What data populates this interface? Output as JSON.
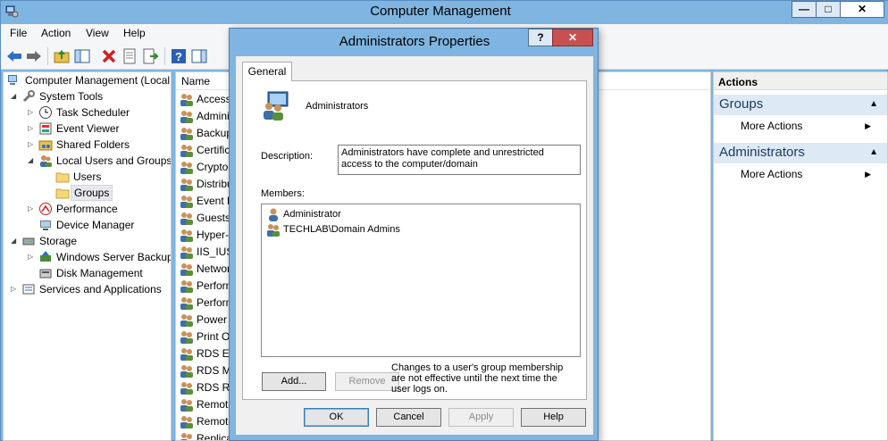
{
  "window": {
    "title": "Computer Management",
    "minimize": "—",
    "maximize": "□",
    "close": "✕"
  },
  "menu": [
    "File",
    "Action",
    "View",
    "Help"
  ],
  "tree": [
    {
      "label": "Computer Management (Local",
      "expander": "",
      "icon": "computer-icon"
    },
    {
      "label": "System Tools",
      "expander": "◢",
      "icon": "tools-icon"
    },
    {
      "label": "Task Scheduler",
      "expander": "▷",
      "icon": "clock-icon"
    },
    {
      "label": "Event Viewer",
      "expander": "▷",
      "icon": "event-viewer-icon"
    },
    {
      "label": "Shared Folders",
      "expander": "▷",
      "icon": "shared-folder-icon"
    },
    {
      "label": "Local Users and Groups",
      "expander": "◢",
      "icon": "users-icon"
    },
    {
      "label": "Users",
      "expander": "",
      "icon": "folder-icon"
    },
    {
      "label": "Groups",
      "expander": "",
      "icon": "folder-icon"
    },
    {
      "label": "Performance",
      "expander": "▷",
      "icon": "performance-icon"
    },
    {
      "label": "Device Manager",
      "expander": "",
      "icon": "device-manager-icon"
    },
    {
      "label": "Storage",
      "expander": "◢",
      "icon": "storage-icon"
    },
    {
      "label": "Windows Server Backup",
      "expander": "▷",
      "icon": "backup-icon"
    },
    {
      "label": "Disk Management",
      "expander": "",
      "icon": "disk-icon"
    },
    {
      "label": "Services and Applications",
      "expander": "▷",
      "icon": "services-icon"
    }
  ],
  "list": {
    "header": "Name",
    "rows": [
      "Access",
      "Admini",
      "Backup",
      "Certific",
      "Cryptog",
      "Distribu",
      "Event L",
      "Guests",
      "Hyper-V",
      "IIS_IUSR",
      "Networ",
      "Perform",
      "Perform",
      "Power U",
      "Print Op",
      "RDS En",
      "RDS Ma",
      "RDS Re",
      "Remote",
      "Remote",
      "Replicat"
    ]
  },
  "actions": {
    "header": "Actions",
    "sections": [
      {
        "title": "Groups",
        "item": "More Actions"
      },
      {
        "title": "Administrators",
        "item": "More Actions"
      }
    ]
  },
  "dialog": {
    "title": "Administrators Properties",
    "help": "?",
    "close": "✕",
    "tab": "General",
    "group_name": "Administrators",
    "description_label": "Description:",
    "description": "Administrators have complete and unrestricted access to the computer/domain",
    "members_label": "Members:",
    "members": [
      "Administrator",
      "TECHLAB\\Domain Admins"
    ],
    "add": "Add...",
    "remove": "Remove",
    "note": "Changes to a user's group membership are not effective until the next time the user logs on.",
    "ok": "OK",
    "cancel": "Cancel",
    "apply": "Apply",
    "help_button": "Help"
  }
}
